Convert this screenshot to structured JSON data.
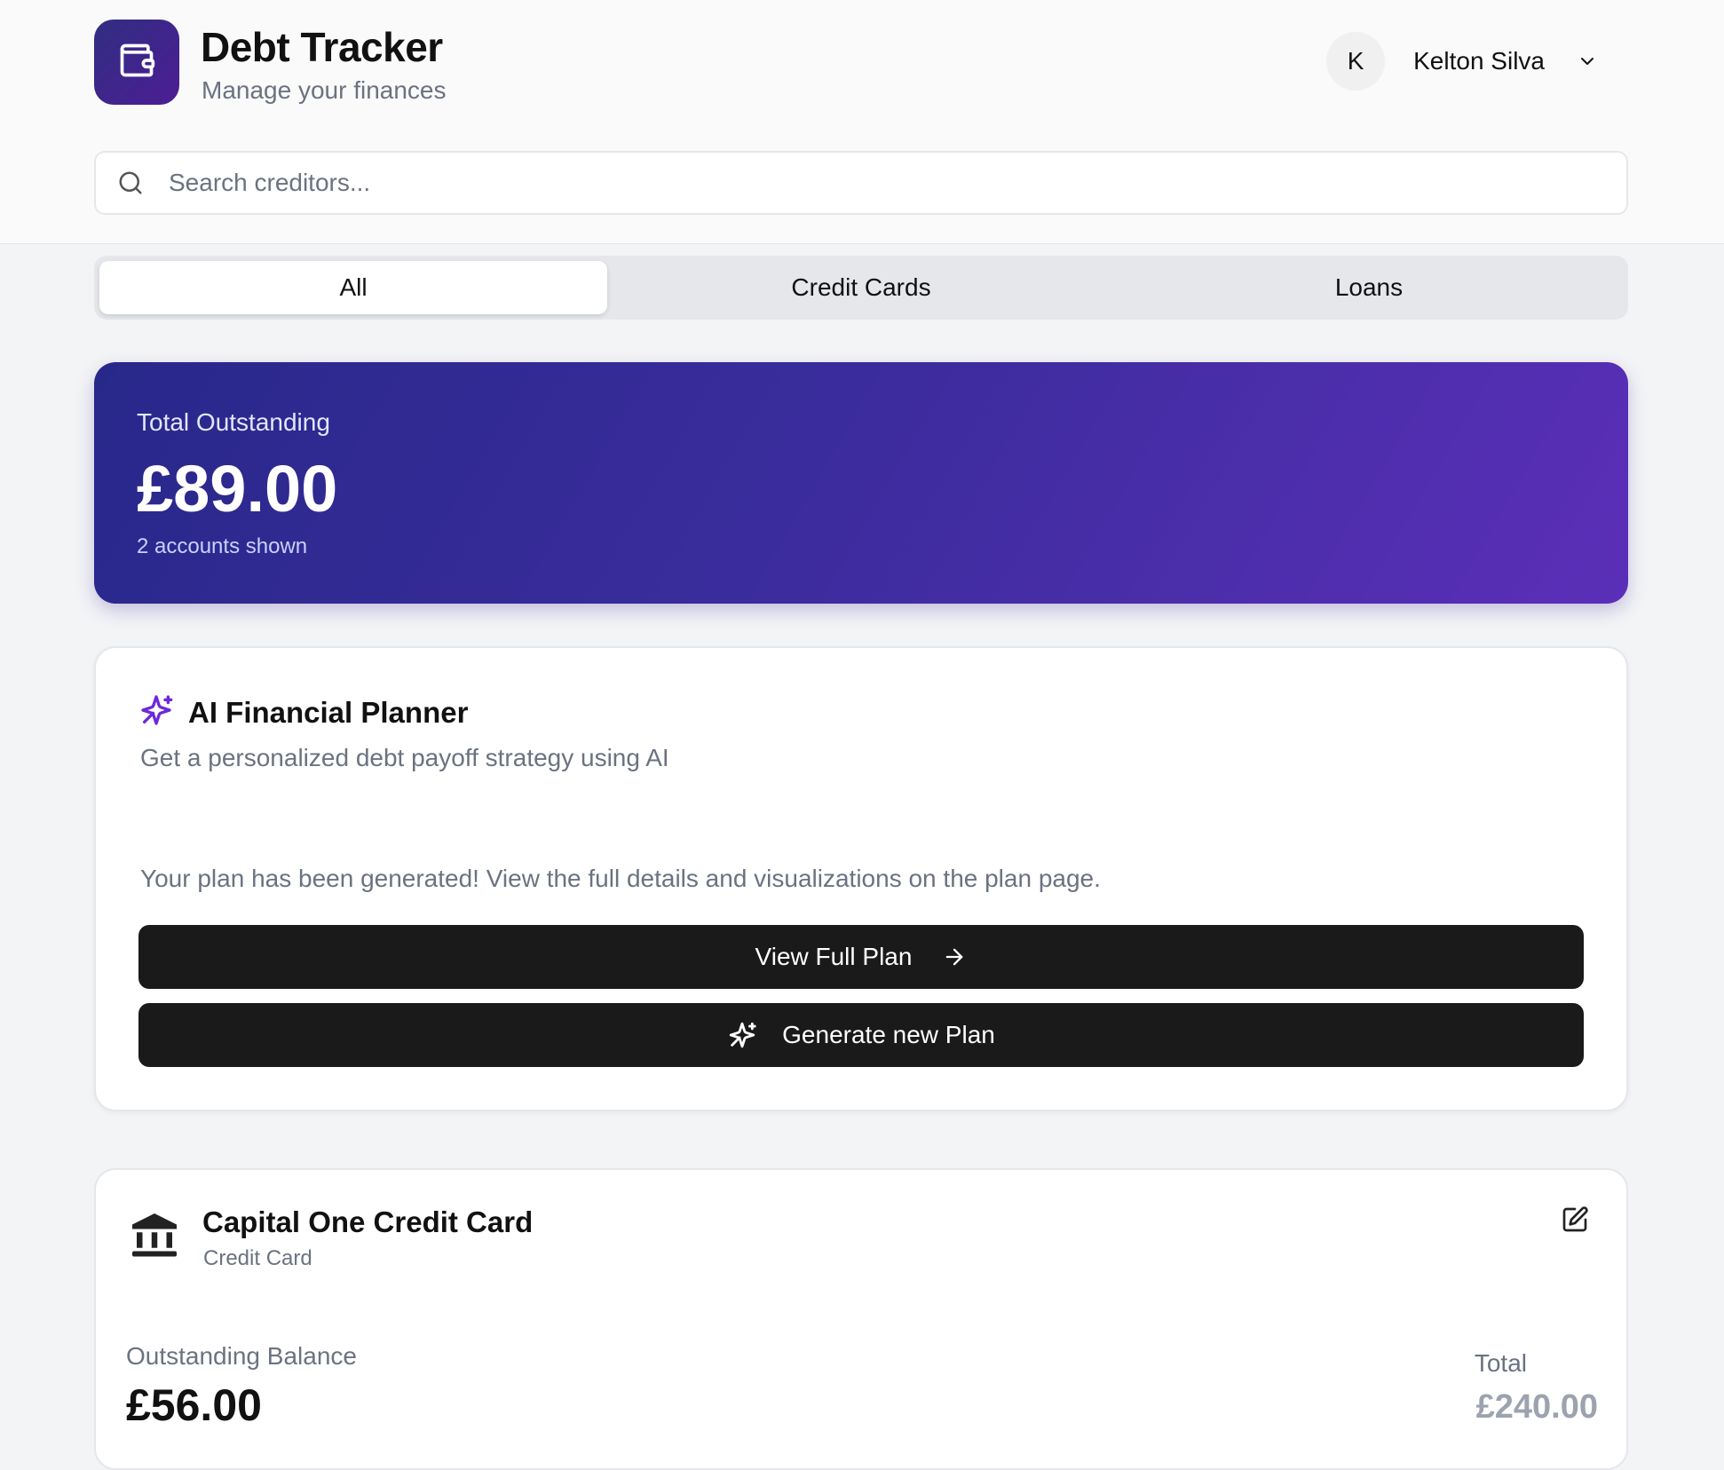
{
  "app": {
    "title": "Debt Tracker",
    "subtitle": "Manage your finances",
    "logo_icon": "wallet-icon"
  },
  "user": {
    "initial": "K",
    "name": "Kelton Silva"
  },
  "search": {
    "placeholder": "Search creditors..."
  },
  "tabs": [
    {
      "label": "All",
      "active": true
    },
    {
      "label": "Credit Cards",
      "active": false
    },
    {
      "label": "Loans",
      "active": false
    }
  ],
  "summary": {
    "label": "Total Outstanding",
    "value": "£89.00",
    "sub": "2 accounts shown"
  },
  "planner": {
    "title": "AI Financial Planner",
    "description": "Get a personalized debt payoff strategy using AI",
    "message": "Your plan has been generated! View the full details and visualizations on the plan page.",
    "view_button": "View Full Plan",
    "generate_button": "Generate new Plan"
  },
  "accounts": [
    {
      "name": "Capital One Credit Card",
      "type": "Credit Card",
      "balance_label": "Outstanding Balance",
      "balance": "£56.00",
      "total_label": "Total",
      "total": "£240.00"
    }
  ],
  "colors": {
    "brand_gradient_start": "#28288a",
    "brand_gradient_end": "#5b2fb8",
    "sparkle": "#6d28d9",
    "button_bg": "#1a1a1a"
  }
}
